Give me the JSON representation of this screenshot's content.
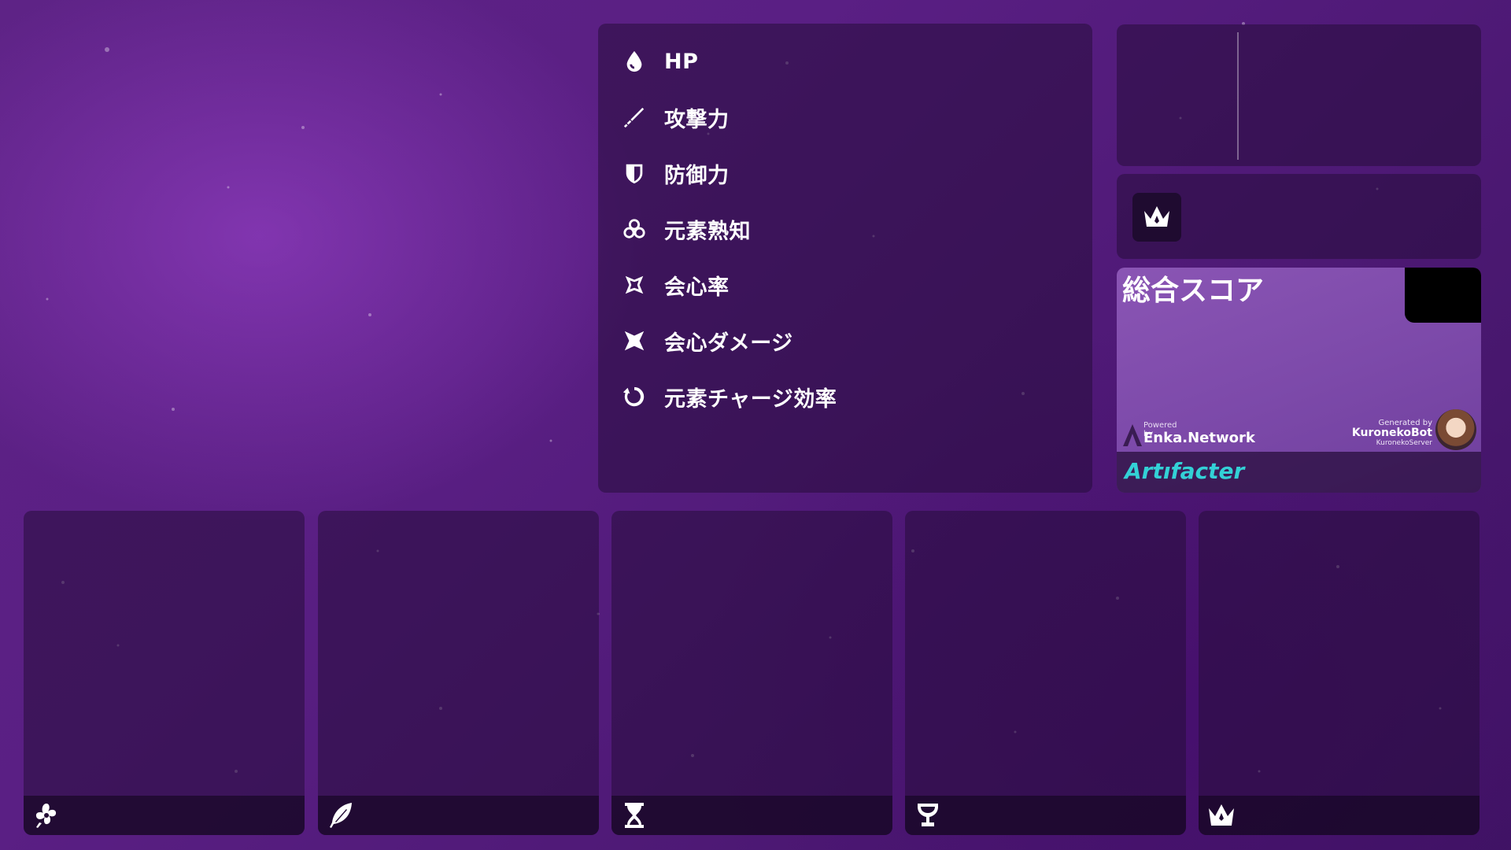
{
  "stats": [
    {
      "label": "HP",
      "icon": "hp-drop-icon"
    },
    {
      "label": "攻撃力",
      "icon": "attack-sword-icon"
    },
    {
      "label": "防御力",
      "icon": "defense-shield-icon"
    },
    {
      "label": "元素熟知",
      "icon": "elemental-mastery-icon"
    },
    {
      "label": "会心率",
      "icon": "crit-rate-icon"
    },
    {
      "label": "会心ダメージ",
      "icon": "crit-damage-icon"
    },
    {
      "label": "元素チャージ効率",
      "icon": "energy-recharge-icon"
    }
  ],
  "set_panel": {
    "icon": "crown-icon"
  },
  "score": {
    "title": "総合スコア",
    "powered_by": "Powered by",
    "enka_name": "Enka.Network",
    "generated_by": "Generated by",
    "bot_name": "KuronekoBot",
    "server_name": "KuronekoServer",
    "brand": "Artıfacter",
    "brand_color": "#33d1d6"
  },
  "artifacts": [
    {
      "slot_icon": "flower-icon"
    },
    {
      "slot_icon": "feather-icon"
    },
    {
      "slot_icon": "hourglass-icon"
    },
    {
      "slot_icon": "goblet-icon"
    },
    {
      "slot_icon": "crown-icon"
    }
  ],
  "colors": {
    "background": "#5a1f84",
    "panel": "#260c3a",
    "text": "#ffffff"
  }
}
